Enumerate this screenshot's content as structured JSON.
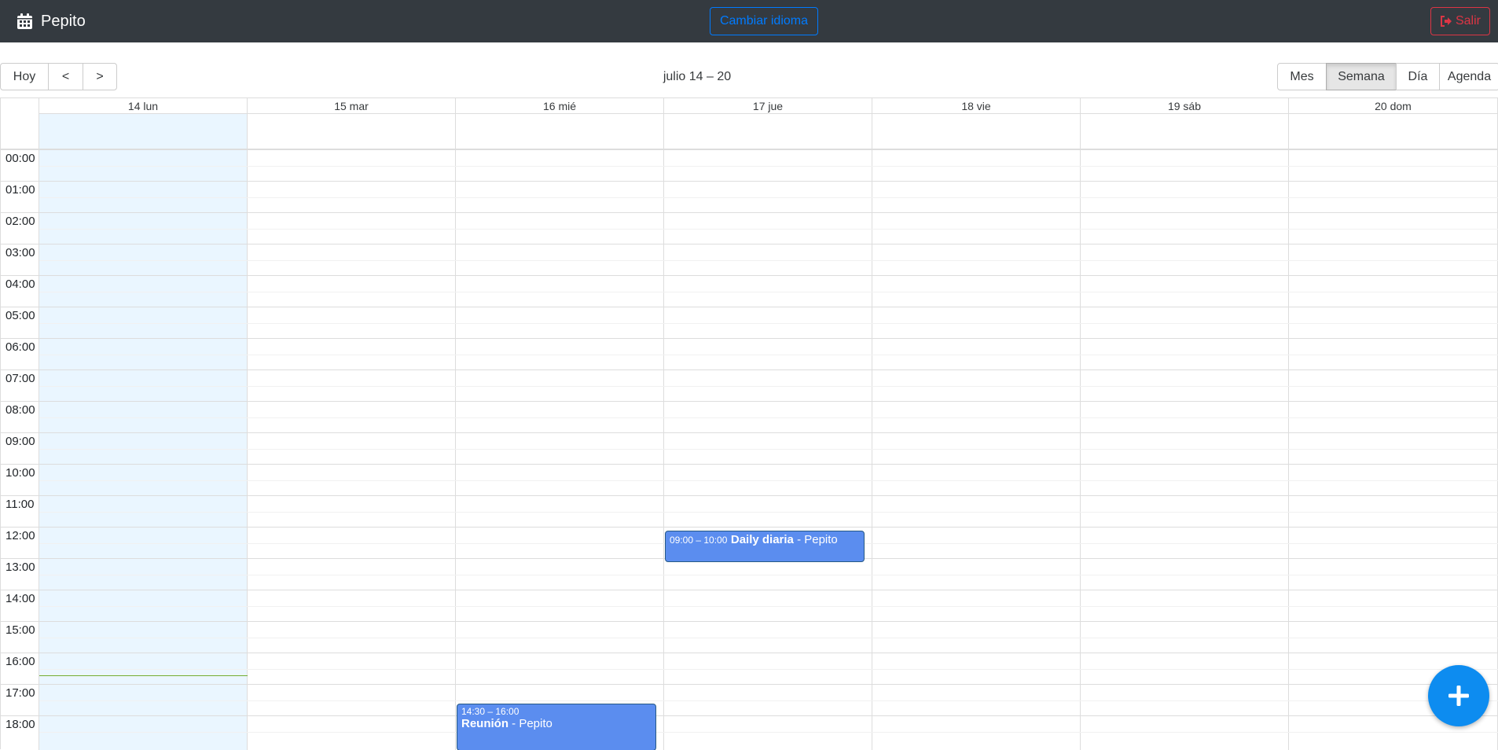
{
  "navbar": {
    "brand": "Pepito",
    "language_button": "Cambiar idioma",
    "exit_button": "Salir"
  },
  "toolbar": {
    "today": "Hoy",
    "prev": "<",
    "next": ">",
    "range_label": "julio 14 – 20",
    "views": [
      "Mes",
      "Semana",
      "Día",
      "Agenda"
    ],
    "active_view": "Semana"
  },
  "calendar": {
    "days": [
      "14 lun",
      "15 mar",
      "16 mié",
      "17 jue",
      "18 vie",
      "19 sáb",
      "20 dom"
    ],
    "today": "14 lun",
    "hours": [
      "00:00",
      "01:00",
      "02:00",
      "03:00",
      "04:00",
      "05:00",
      "06:00",
      "07:00",
      "08:00",
      "09:00",
      "10:00",
      "11:00",
      "12:00",
      "13:00",
      "14:00",
      "15:00",
      "16:00",
      "17:00",
      "18:00"
    ],
    "events": [
      {
        "time": "09:00 – 10:00",
        "title": "Daily diaria",
        "owner": " - Pepito",
        "day": "17 jue"
      },
      {
        "time": "14:30 – 16:00",
        "title": "Reunión",
        "owner": " - Pepito",
        "day": "16 mié"
      }
    ]
  },
  "colors": {
    "navbar": "#343a40",
    "event": "#5b8def",
    "today_bg": "#eaf6ff",
    "fab": "#0d8cf0",
    "now_indicator": "#74ad31"
  },
  "fab": {
    "icon": "plus-icon"
  }
}
